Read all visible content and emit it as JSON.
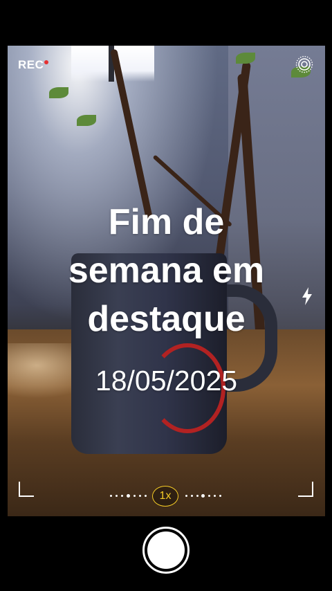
{
  "status": {
    "rec_label": "REC"
  },
  "overlay": {
    "title_lines": [
      "Fim de",
      "semana em",
      "destaque"
    ],
    "date": "18/05/2025"
  },
  "camera": {
    "zoom_label": "1x"
  },
  "icons": {
    "rec_dot": "record-dot-icon",
    "live": "live-photo-icon",
    "flash": "flash-icon",
    "shutter": "shutter-button"
  },
  "colors": {
    "zoom_accent": "#f4cb26",
    "rec_dot": "#e53030"
  }
}
